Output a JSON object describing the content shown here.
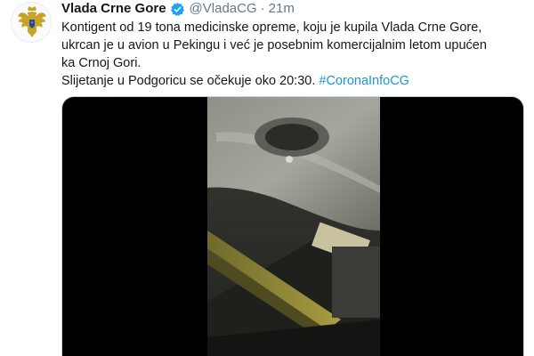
{
  "tweet": {
    "author": {
      "display_name": "Vlada Crne Gore",
      "handle": "@VladaCG",
      "verified_icon": "verified-badge-icon",
      "avatar_icon": "montenegro-coat-of-arms-icon"
    },
    "separator": "·",
    "time": "21m",
    "text": {
      "line1": "Kontigent od 19 tona medicinske opreme, koju je kupila Vlada Crne Gore,",
      "line2": "ukrcan je u avion u Pekingu i već je posebnim komercijalnim letom upućen",
      "line3": "ka Crnoj Gori.",
      "line4_prefix": "Slijetanje u Podgoricu se očekuje oko 20:30.",
      "hashtag": "#CoronaInfoCG"
    },
    "media": {
      "type": "video",
      "description_icon": "video-thumbnail"
    }
  },
  "colors": {
    "link": "#1b95e0",
    "verified": "#1da1f2",
    "secondary_text": "#657786"
  }
}
